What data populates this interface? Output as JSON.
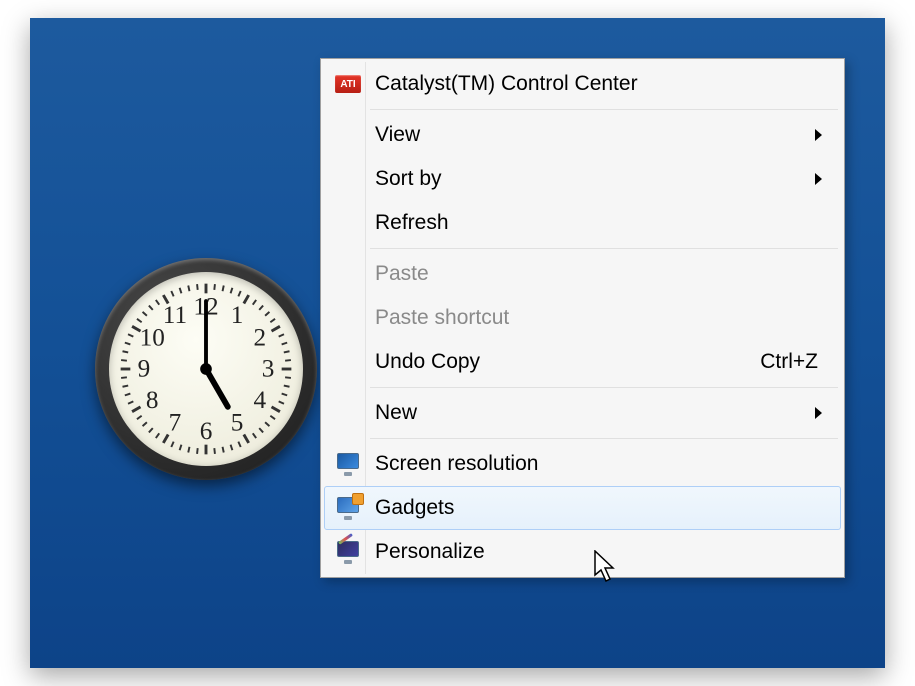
{
  "clock": {
    "numerals": [
      "12",
      "1",
      "2",
      "3",
      "4",
      "5",
      "6",
      "7",
      "8",
      "9",
      "10",
      "11"
    ],
    "hour_hand_angle": 150,
    "minute_hand_angle": 0
  },
  "menu": {
    "items": [
      {
        "id": "catalyst",
        "label": "Catalyst(TM) Control Center",
        "icon": "ati",
        "submenu": false,
        "disabled": false
      },
      {
        "sep": true
      },
      {
        "id": "view",
        "label": "View",
        "submenu": true,
        "disabled": false
      },
      {
        "id": "sortby",
        "label": "Sort by",
        "submenu": true,
        "disabled": false
      },
      {
        "id": "refresh",
        "label": "Refresh",
        "submenu": false,
        "disabled": false
      },
      {
        "sep": true
      },
      {
        "id": "paste",
        "label": "Paste",
        "submenu": false,
        "disabled": true
      },
      {
        "id": "paste-shortcut",
        "label": "Paste shortcut",
        "submenu": false,
        "disabled": true
      },
      {
        "id": "undo-copy",
        "label": "Undo Copy",
        "shortcut": "Ctrl+Z",
        "submenu": false,
        "disabled": false
      },
      {
        "sep": true
      },
      {
        "id": "new",
        "label": "New",
        "submenu": true,
        "disabled": false
      },
      {
        "sep": true
      },
      {
        "id": "screen-resolution",
        "label": "Screen resolution",
        "icon": "resolution",
        "submenu": false,
        "disabled": false
      },
      {
        "id": "gadgets",
        "label": "Gadgets",
        "icon": "gadgets",
        "submenu": false,
        "disabled": false,
        "hover": true
      },
      {
        "id": "personalize",
        "label": "Personalize",
        "icon": "personalize",
        "submenu": false,
        "disabled": false
      }
    ]
  }
}
